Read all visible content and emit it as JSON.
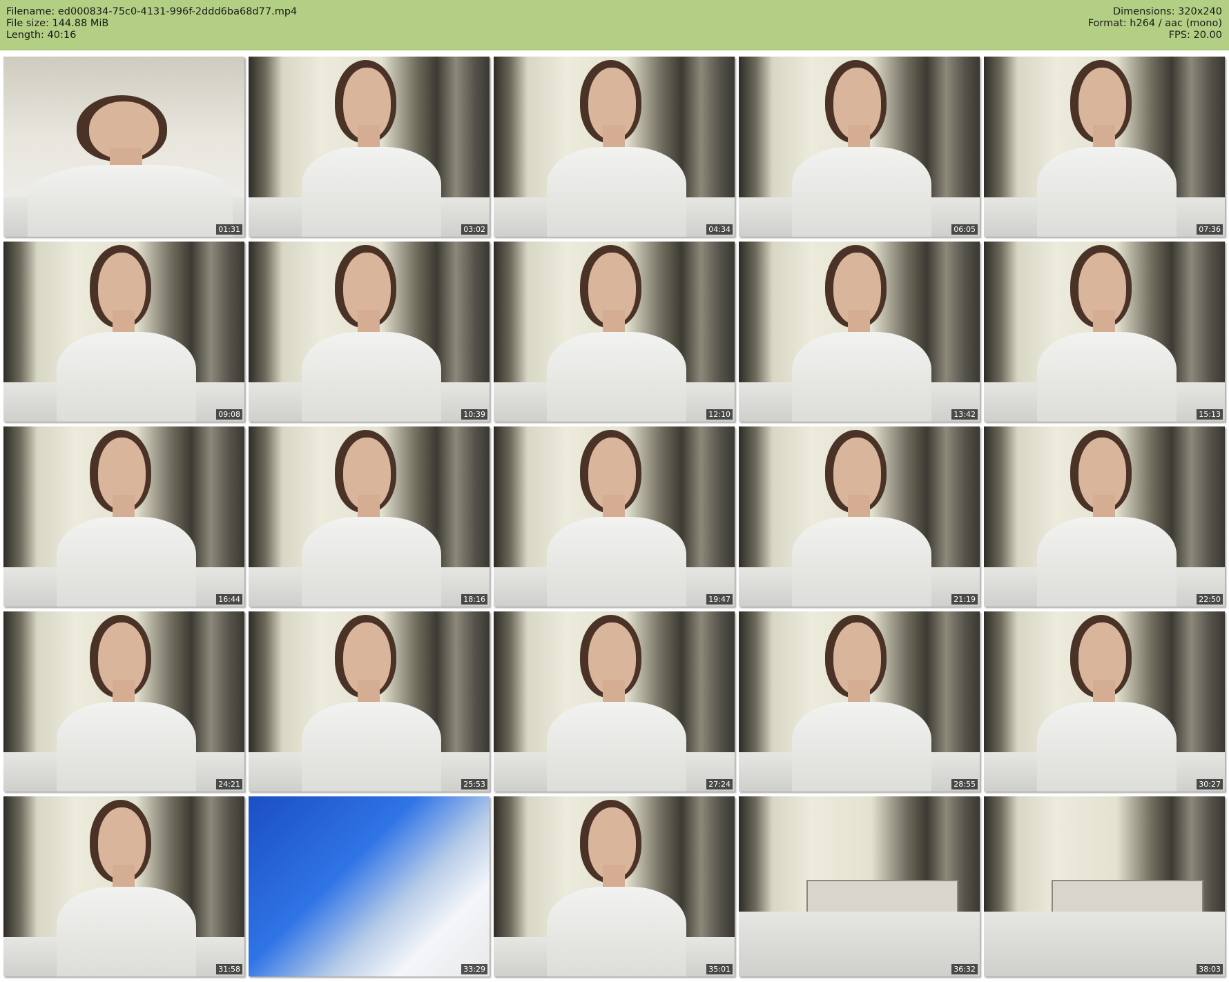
{
  "header": {
    "filename_line": "Filename: ed000834-75c0-4131-996f-2ddd6ba68d77.mp4",
    "filesize_line": "File size: 144.88 MiB",
    "length_line": "Length: 40:16",
    "dimensions_line": "Dimensions: 320x240",
    "format_line": "Format: h264 / aac (mono)",
    "fps_line": "FPS: 20.00"
  },
  "colors": {
    "header_background": "#b3cf84",
    "page_background": "#ffffff",
    "timestamp_background": "#141414",
    "timestamp_text": "#ffffff"
  },
  "thumbnails": [
    {
      "time": "01:31"
    },
    {
      "time": "03:02"
    },
    {
      "time": "04:34"
    },
    {
      "time": "06:05"
    },
    {
      "time": "07:36"
    },
    {
      "time": "09:08"
    },
    {
      "time": "10:39"
    },
    {
      "time": "12:10"
    },
    {
      "time": "13:42"
    },
    {
      "time": "15:13"
    },
    {
      "time": "16:44"
    },
    {
      "time": "18:16"
    },
    {
      "time": "19:47"
    },
    {
      "time": "21:19"
    },
    {
      "time": "22:50"
    },
    {
      "time": "24:21"
    },
    {
      "time": "25:53"
    },
    {
      "time": "27:24"
    },
    {
      "time": "28:55"
    },
    {
      "time": "30:27"
    },
    {
      "time": "31:58"
    },
    {
      "time": "33:29"
    },
    {
      "time": "35:01"
    },
    {
      "time": "36:32"
    },
    {
      "time": "38:03"
    }
  ]
}
